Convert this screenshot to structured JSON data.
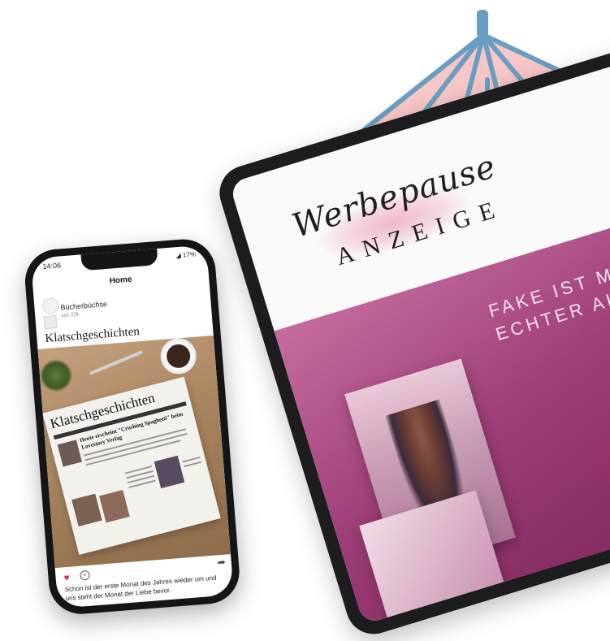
{
  "phone": {
    "status_time": "14:06",
    "status_battery": "17%",
    "nav_title": "Home",
    "author_name": "Bücherbüchse",
    "post_age": "vor 23t",
    "post_title": "Klatschgeschichten",
    "newspaper": {
      "title": "Klatschgeschichten",
      "headline": "Heute erscheint \"Crushing Spaghetti\" beim Lovestory Verlag"
    },
    "icons": [
      "heart-icon",
      "comment-icon",
      "share-icon"
    ],
    "post_text": "Schon ist der erste Monat des Jahres wieder um und uns steht der Monat der Liebe bevor."
  },
  "tablet": {
    "script_title": "Werbepause",
    "caps_title": "ANZEIGE",
    "tagline_line1": "FAKE IST MANCHMAL",
    "tagline_line2": "ECHTER ALS ECHT"
  },
  "colors": {
    "umbrella_canopy": "#f7c6c7",
    "umbrella_frame": "#6a9ec0",
    "ad_magenta": "#9f3f78",
    "like_red": "#e0245e"
  }
}
